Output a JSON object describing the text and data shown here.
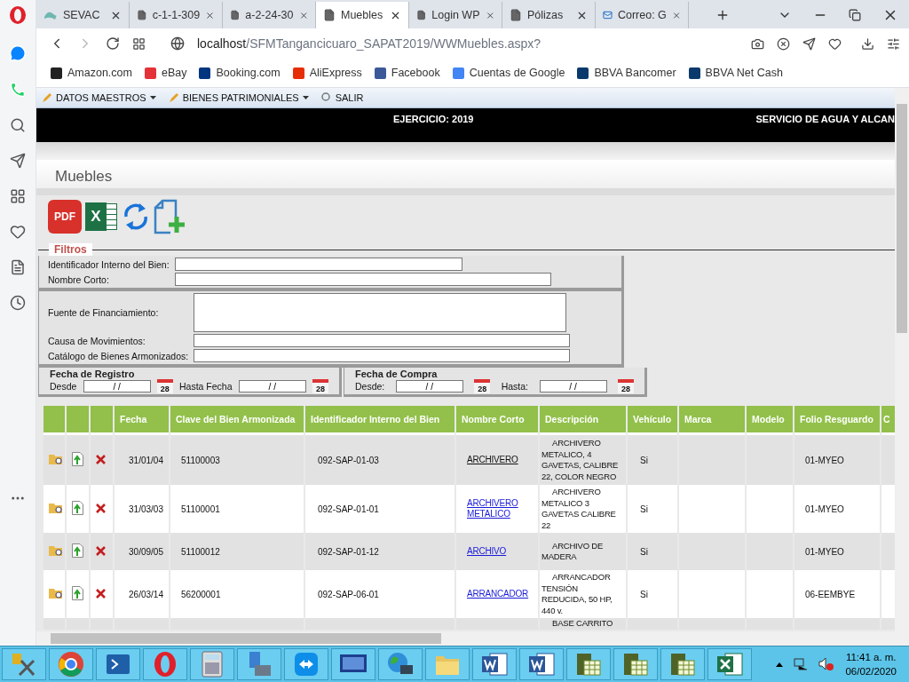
{
  "browser": {
    "tabs": [
      {
        "title": "SEVAC",
        "selected": false,
        "kind": "site"
      },
      {
        "title": "c-1-1-309",
        "selected": false,
        "kind": "page"
      },
      {
        "title": "a-2-24-30",
        "selected": false,
        "kind": "page"
      },
      {
        "title": "Muebles",
        "selected": true,
        "kind": "page"
      },
      {
        "title": "Login WP",
        "selected": false,
        "kind": "page"
      },
      {
        "title": "Pólizas",
        "selected": false,
        "kind": "page"
      },
      {
        "title": "Correo: G",
        "selected": false,
        "kind": "mail"
      }
    ],
    "address": {
      "host": "localhost",
      "path": "/SFMTangancicuaro_SAPAT2019/WWMuebles.aspx?"
    },
    "bookmarks": [
      {
        "label": "Amazon.com",
        "color": "#222222"
      },
      {
        "label": "eBay",
        "color": "#e53238"
      },
      {
        "label": "Booking.com",
        "color": "#003580"
      },
      {
        "label": "AliExpress",
        "color": "#e62e04"
      },
      {
        "label": "Facebook",
        "color": "#3b5998"
      },
      {
        "label": "Cuentas de Google",
        "color": "#4285f4"
      },
      {
        "label": "BBVA Bancomer",
        "color": "#0a3a6b"
      },
      {
        "label": "BBVA Net Cash",
        "color": "#0a3a6b"
      }
    ]
  },
  "menu": [
    {
      "label": "DATOS MAESTROS",
      "dropdown": true
    },
    {
      "label": "BIENES PATRIMONIALES",
      "dropdown": true
    },
    {
      "label": "SALIR",
      "dropdown": false
    }
  ],
  "header": {
    "exercise": "EJERCICIO: 2019",
    "organization": "SERVICIO DE AGUA Y ALCAN"
  },
  "page_title": "Muebles",
  "toolbar": [
    {
      "kind": "pdf",
      "label": "PDF"
    },
    {
      "kind": "excel",
      "label": "X"
    },
    {
      "kind": "refresh"
    },
    {
      "kind": "new"
    }
  ],
  "filters": {
    "legend": "Filtros",
    "groups": [
      [
        {
          "label": "Identificador Interno del Bien:",
          "kind": "line"
        },
        {
          "label": "Nombre Corto:",
          "kind": "line"
        }
      ],
      [
        {
          "label": "Fuente de Financiamiento:",
          "kind": "area"
        },
        {
          "label": "Causa de Movimientos:",
          "kind": "line"
        },
        {
          "label": "Catálogo de Bienes Armonizados:",
          "kind": "line"
        }
      ]
    ],
    "date_groups": [
      {
        "title": "Fecha de Registro",
        "fields": [
          {
            "label": "Desde",
            "value": "/ /",
            "calendar": "28"
          },
          {
            "label": "Hasta Fecha",
            "value": "/ /",
            "calendar": "28"
          }
        ]
      },
      {
        "title": "Fecha de Compra",
        "fields": [
          {
            "label": "Desde:",
            "value": "/ /",
            "calendar": "28"
          },
          {
            "label": "Hasta:",
            "value": "/ /",
            "calendar": "28"
          }
        ]
      }
    ]
  },
  "table": {
    "columns": [
      "Fecha",
      "Clave del Bien Armonizada",
      "Identificador Interno del Bien",
      "Nombre Corto",
      "Descripción",
      "Vehículo",
      "Marca",
      "Modelo",
      "Folio Resguardo",
      "C"
    ],
    "rows": [
      {
        "fecha": "31/01/04",
        "clave": "51100003",
        "identificador": "092-SAP-01-03",
        "nombre": "ARCHIVERO",
        "visited": true,
        "descripcion": "ARCHIVERO METALICO, 4 GAVETAS, CALIBRE 22, COLOR NEGRO",
        "vehiculo": "Si",
        "folio": "01-MYEO"
      },
      {
        "fecha": "31/03/03",
        "clave": "51100001",
        "identificador": "092-SAP-01-01",
        "nombre": "ARCHIVERO METALICO",
        "visited": false,
        "descripcion": "ARCHIVERO METALICO 3 GAVETAS CALIBRE 22",
        "vehiculo": "Si",
        "folio": "01-MYEO"
      },
      {
        "fecha": "30/09/05",
        "clave": "51100012",
        "identificador": "092-SAP-01-12",
        "nombre": "ARCHIVO",
        "visited": false,
        "descripcion": "ARCHIVO DE MADERA",
        "vehiculo": "Si",
        "folio": "01-MYEO"
      },
      {
        "fecha": "26/03/14",
        "clave": "56200001",
        "identificador": "092-SAP-06-01",
        "nombre": "ARRANCADOR",
        "visited": false,
        "descripcion": "ARRANCADOR TENSIÓN REDUCIDA, 50 HP, 440 v.",
        "vehiculo": "Si",
        "folio": "06-EEMBYE"
      }
    ],
    "partial_row": {
      "descripcion": "BASE CARRITO"
    }
  },
  "taskbar": {
    "apps": [
      {
        "kind": "tools"
      },
      {
        "kind": "chrome"
      },
      {
        "kind": "powershell"
      },
      {
        "kind": "opera"
      },
      {
        "kind": "calculator"
      },
      {
        "kind": "network"
      },
      {
        "kind": "teamviewer"
      },
      {
        "kind": "desktop"
      },
      {
        "kind": "internet"
      },
      {
        "kind": "folder"
      },
      {
        "kind": "word"
      },
      {
        "kind": "word"
      },
      {
        "kind": "project"
      },
      {
        "kind": "project"
      },
      {
        "kind": "project"
      },
      {
        "kind": "excel"
      }
    ],
    "time": "11:41 a. m.",
    "date": "06/02/2020"
  }
}
